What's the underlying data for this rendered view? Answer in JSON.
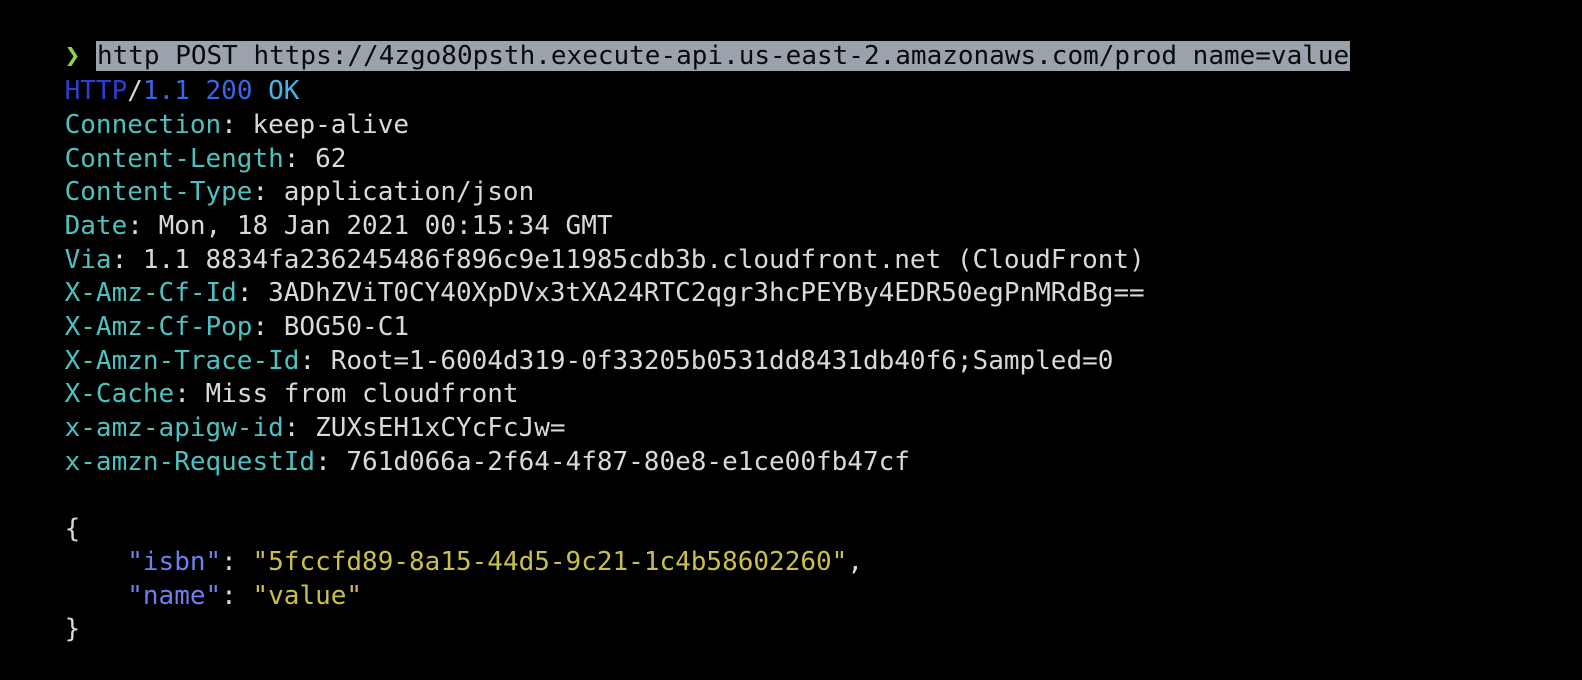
{
  "prompt": {
    "symbol": "❯",
    "command": "http POST https://4zgo80psth.execute-api.us-east-2.amazonaws.com/prod name=value"
  },
  "status_line": {
    "protocol": "HTTP",
    "slash": "/",
    "version": "1.1",
    "code": "200",
    "text": "OK"
  },
  "headers": [
    {
      "key": "Connection",
      "value": "keep-alive"
    },
    {
      "key": "Content-Length",
      "value": "62"
    },
    {
      "key": "Content-Type",
      "value": "application/json"
    },
    {
      "key": "Date",
      "value": "Mon, 18 Jan 2021 00:15:34 GMT"
    },
    {
      "key": "Via",
      "value": "1.1 8834fa236245486f896c9e11985cdb3b.cloudfront.net (CloudFront)"
    },
    {
      "key": "X-Amz-Cf-Id",
      "value": "3ADhZViT0CY40XpDVx3tXA24RTC2qgr3hcPEYBy4EDR50egPnMRdBg=="
    },
    {
      "key": "X-Amz-Cf-Pop",
      "value": "BOG50-C1"
    },
    {
      "key": "X-Amzn-Trace-Id",
      "value": "Root=1-6004d319-0f33205b0531dd8431db40f6;Sampled=0"
    },
    {
      "key": "X-Cache",
      "value": "Miss from cloudfront"
    },
    {
      "key": "x-amz-apigw-id",
      "value": "ZUXsEH1xCYcFcJw="
    },
    {
      "key": "x-amzn-RequestId",
      "value": "761d066a-2f64-4f87-80e8-e1ce00fb47cf"
    }
  ],
  "body": {
    "open_brace": "{",
    "close_brace": "}",
    "fields": [
      {
        "key": "\"isbn\"",
        "value": "\"5fccfd89-8a15-44d5-9c21-1c4b58602260\"",
        "trailing": ","
      },
      {
        "key": "\"name\"",
        "value": "\"value\"",
        "trailing": ""
      }
    ]
  },
  "colors": {
    "background": "#000000",
    "foreground": "#d9d9d9",
    "prompt_arrow": "#8fd14a",
    "selection_bg": "#9aa3ab",
    "header_key": "#4fc0c0",
    "json_key": "#6f7ff0",
    "json_string": "#c9c04a",
    "status_blue": "#3a66e6"
  }
}
